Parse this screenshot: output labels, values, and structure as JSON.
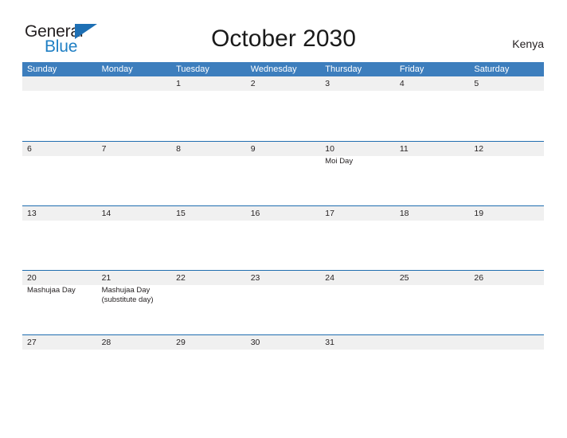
{
  "brand": {
    "name_part1": "General",
    "name_part2": "Blue",
    "logo_icon": "triangle-flag-icon",
    "color_primary": "#1d6fb4",
    "color_text": "#231f20"
  },
  "header": {
    "title": "October 2030",
    "region": "Kenya"
  },
  "calendar": {
    "header_background": "#3d7ebd",
    "band_background": "#f0f0f0",
    "row_border_color": "#1f6daf",
    "weekdays": [
      "Sunday",
      "Monday",
      "Tuesday",
      "Wednesday",
      "Thursday",
      "Friday",
      "Saturday"
    ],
    "weeks": [
      [
        {
          "day": "",
          "events": []
        },
        {
          "day": "",
          "events": []
        },
        {
          "day": "1",
          "events": []
        },
        {
          "day": "2",
          "events": []
        },
        {
          "day": "3",
          "events": []
        },
        {
          "day": "4",
          "events": []
        },
        {
          "day": "5",
          "events": []
        }
      ],
      [
        {
          "day": "6",
          "events": []
        },
        {
          "day": "7",
          "events": []
        },
        {
          "day": "8",
          "events": []
        },
        {
          "day": "9",
          "events": []
        },
        {
          "day": "10",
          "events": [
            "Moi Day"
          ]
        },
        {
          "day": "11",
          "events": []
        },
        {
          "day": "12",
          "events": []
        }
      ],
      [
        {
          "day": "13",
          "events": []
        },
        {
          "day": "14",
          "events": []
        },
        {
          "day": "15",
          "events": []
        },
        {
          "day": "16",
          "events": []
        },
        {
          "day": "17",
          "events": []
        },
        {
          "day": "18",
          "events": []
        },
        {
          "day": "19",
          "events": []
        }
      ],
      [
        {
          "day": "20",
          "events": [
            "Mashujaa Day"
          ]
        },
        {
          "day": "21",
          "events": [
            "Mashujaa Day\n(substitute day)"
          ]
        },
        {
          "day": "22",
          "events": []
        },
        {
          "day": "23",
          "events": []
        },
        {
          "day": "24",
          "events": []
        },
        {
          "day": "25",
          "events": []
        },
        {
          "day": "26",
          "events": []
        }
      ],
      [
        {
          "day": "27",
          "events": []
        },
        {
          "day": "28",
          "events": []
        },
        {
          "day": "29",
          "events": []
        },
        {
          "day": "30",
          "events": []
        },
        {
          "day": "31",
          "events": []
        },
        {
          "day": "",
          "events": []
        },
        {
          "day": "",
          "events": []
        }
      ]
    ]
  }
}
